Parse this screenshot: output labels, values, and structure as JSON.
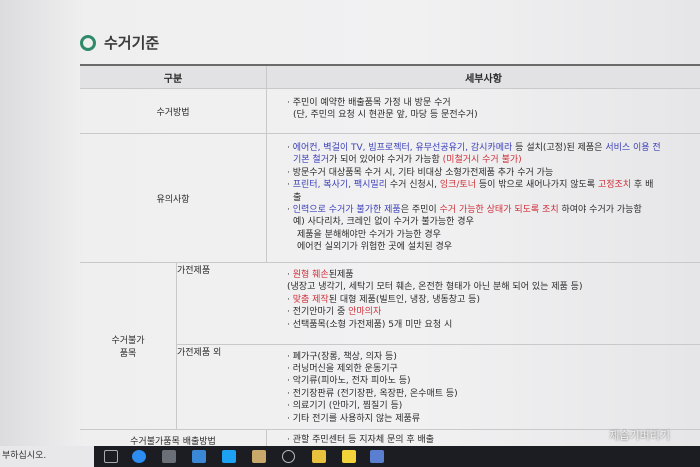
{
  "section_title": "수거기준",
  "table": {
    "header": {
      "col1": "구분",
      "col2": "세부사항"
    },
    "pickup_method": {
      "label": "수거방법",
      "lines": [
        "· 주민이 예약한 배출품목 가정 내 방문 수거",
        "(단, 주민의 요청 시 현관문 앞, 마당 등 문전수거)"
      ]
    },
    "notes": {
      "label": "유의사항",
      "l1_a": "· ",
      "l1_b": "에어컨, 벽걸이 TV, 빔프로젝터, 유무선공유기, 감시카메라",
      "l1_c": " 등 설치(고정)된 제품은 ",
      "l1_d": "서비스 이용 전",
      "l2_a": "기본 철거",
      "l2_b": "가 되어 있어야 수거가 가능함 ",
      "l2_c": "(미철거시 수거 불가)",
      "l3": "· 방문수거 대상품목 수거 시, 기타 비대상 소형가전제품 추가 수거 가능",
      "l4_a": "· ",
      "l4_b": "프린터, 복사기, 팩시밀리",
      "l4_c": " 수거 신청시, ",
      "l4_d": "잉크/토너",
      "l4_e": " 등이 밖으로 새어나가지 않도록 ",
      "l4_f": "고정조치",
      "l4_g": " 후 배",
      "l5": "출",
      "l6_a": "· ",
      "l6_b": "인력으로 수거가 불가한 제품",
      "l6_c": "은 주민이 ",
      "l6_d": "수거 가능한 상태가 되도록 조치",
      "l6_e": " 하여야 수거가 가능함",
      "l7": "예) 사다리차, 크레인 없이 수거가 불가능한 경우",
      "l8": "제품을 분해해야만 수거가 가능한 경우",
      "l9": "에어컨 실외기가 위험한 곳에 설치된 경우"
    },
    "not_collectible": {
      "label_1": "수거불가",
      "label_2": "품목",
      "appliances": {
        "label": "가전제품",
        "l1_a": "· ",
        "l1_b": "원형 훼손",
        "l1_c": "된제품",
        "l2": "(냉장고 냉각기, 세탁기 모터 훼손, 온전한 형태가 아닌 분해 되어 있는 제품 등)",
        "l3_a": "· ",
        "l3_b": "맞춤 제작",
        "l3_c": "된 대형 제품(빌트인, 냉장, 냉동창고 등)",
        "l4_a": "· 전기안마기 중 ",
        "l4_b": "안마의자",
        "l5": "· 선택품목(소형 가전제품) 5개 미만 요청 시"
      },
      "others": {
        "label": "가전제품 외",
        "items": [
          "· 폐가구(장롱, 책상, 의자 등)",
          "· 러닝머신을 제외한 운동기구",
          "· 악기류(피아노, 전자 피아노 등)",
          "· 전기장판류 (전기장판, 옥장판, 온수매트 등)",
          "· 의료기기 (안마기, 찜질기 등)",
          "· 기타 전기를 사용하지 않는 제품류"
        ]
      }
    },
    "disposal": {
      "label": "수거불가품목 배출방법",
      "line": "· 관할 주민센터 등 지자체 문의 후 배출"
    }
  },
  "taskbar": {
    "left_text": "부하십시오."
  },
  "watermark": "제습기버리기",
  "colors": {
    "emphasis_blue": "#3b3fb8",
    "emphasis_red": "#d0303a",
    "title_ring": "#2f8a6a"
  }
}
